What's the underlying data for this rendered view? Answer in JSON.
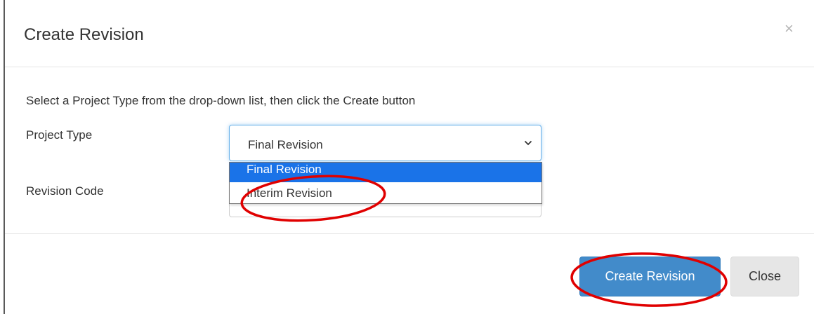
{
  "modal": {
    "title": "Create Revision",
    "close_symbol": "×",
    "instruction": "Select a Project Type from the drop-down list, then click the Create button"
  },
  "form": {
    "project_type_label": "Project Type",
    "project_type_value": "Final Revision",
    "revision_code_label": "Revision Code",
    "revision_code_value": "",
    "dropdown_options": [
      "Final Revision",
      "Interim Revision"
    ],
    "highlighted_option": "Final Revision"
  },
  "footer": {
    "create_label": "Create Revision",
    "close_label": "Close"
  },
  "colors": {
    "primary": "#428bca",
    "highlight": "#1a73e8",
    "annotation": "#e00000"
  },
  "icons": {
    "dropdown": "chevron-down-icon",
    "close": "close-icon"
  }
}
